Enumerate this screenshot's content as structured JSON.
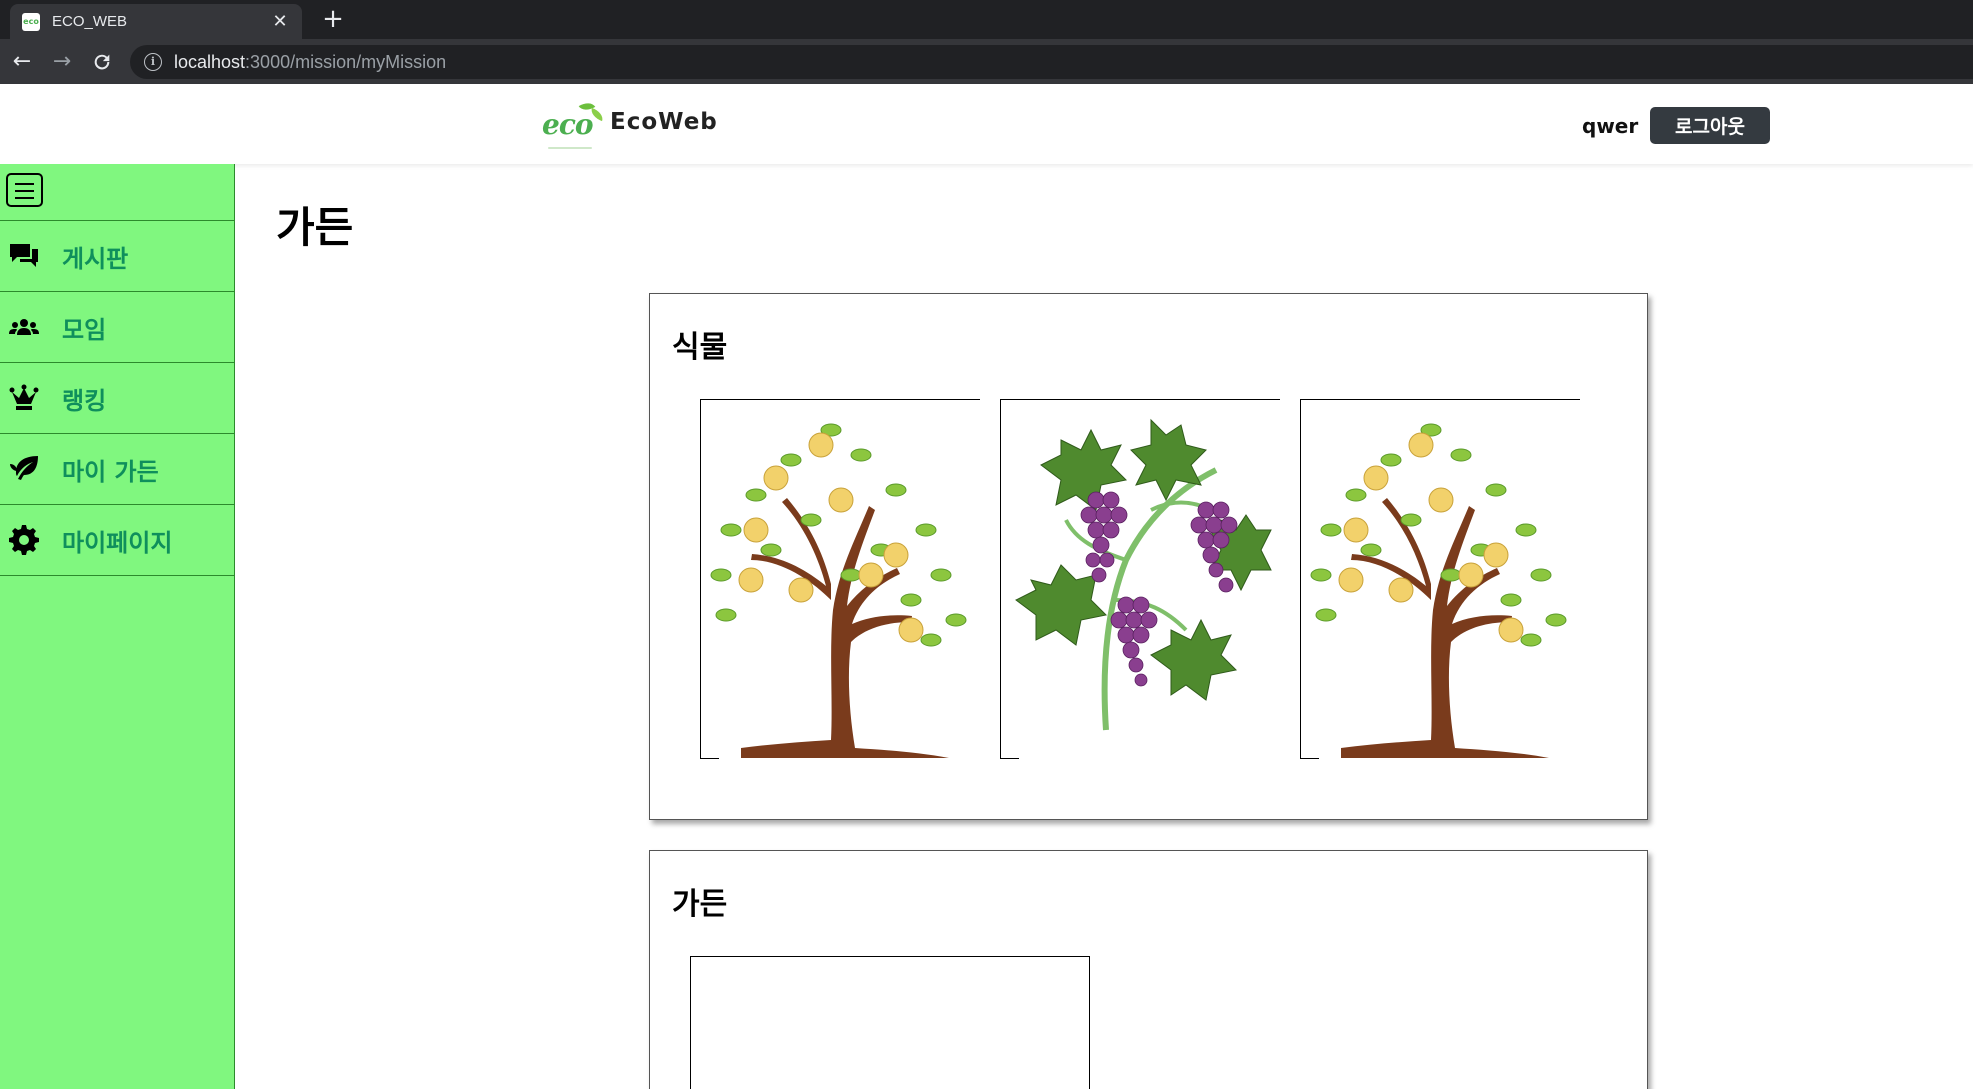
{
  "browser": {
    "tab_title": "ECO_WEB",
    "tab_favicon": "eco",
    "url_host": "localhost",
    "url_path": ":3000/mission/myMission"
  },
  "header": {
    "logo_text": "eco",
    "brand_name": "EcoWeb",
    "username": "qwer",
    "logout_label": "로그아웃"
  },
  "sidebar": {
    "items": [
      {
        "label": "게시판",
        "icon": "chat-bubbles-icon"
      },
      {
        "label": "모임",
        "icon": "users-icon"
      },
      {
        "label": "랭킹",
        "icon": "crown-icon"
      },
      {
        "label": "마이 가든",
        "icon": "leaf-icon"
      },
      {
        "label": "마이페이지",
        "icon": "gear-icon"
      }
    ]
  },
  "main": {
    "page_title": "가든",
    "plants_title": "식물",
    "plants": [
      {
        "name": "apple-tree"
      },
      {
        "name": "grape-vine"
      },
      {
        "name": "apple-tree"
      }
    ],
    "garden_title": "가든"
  },
  "colors": {
    "sidebar_bg": "#80f77f",
    "menu_text": "#0f8f5c",
    "logout_bg": "#343a40",
    "brand_green": "#4caf50"
  }
}
